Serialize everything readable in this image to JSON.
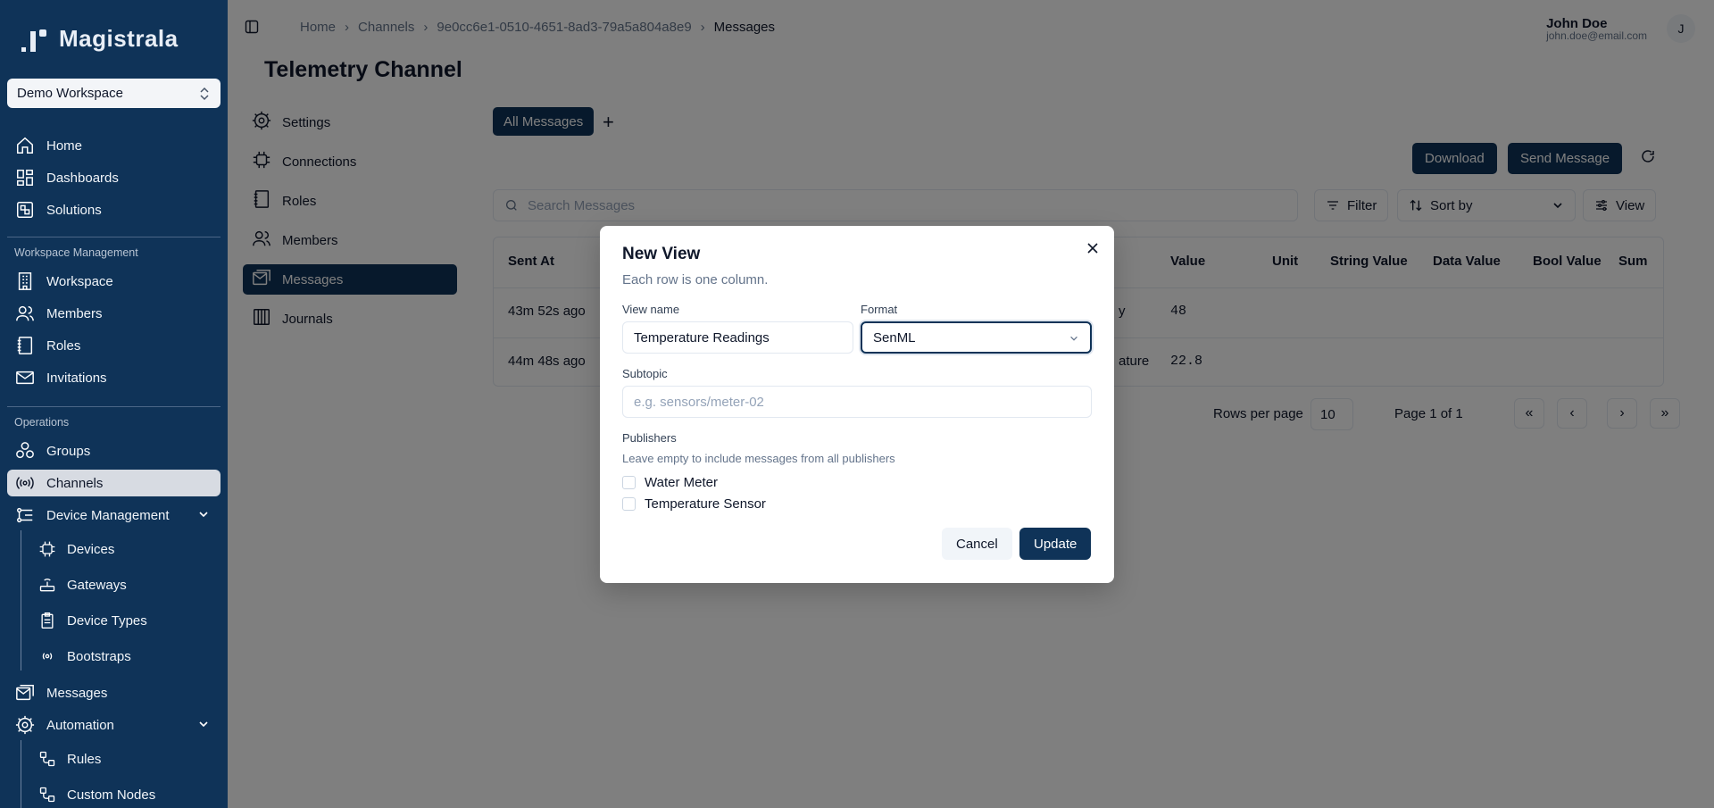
{
  "sidebar": {
    "brand": "Magistrala",
    "workspace": "Demo Workspace",
    "nav_top": [
      {
        "label": "Home",
        "icon": "home-icon"
      },
      {
        "label": "Dashboards",
        "icon": "dashboard-icon"
      },
      {
        "label": "Solutions",
        "icon": "solutions-icon"
      }
    ],
    "section_workspace": "Workspace Management",
    "nav_workspace": [
      {
        "label": "Workspace",
        "icon": "building-icon"
      },
      {
        "label": "Members",
        "icon": "users-icon"
      },
      {
        "label": "Roles",
        "icon": "notebook-icon"
      },
      {
        "label": "Invitations",
        "icon": "mail-icon"
      }
    ],
    "section_operations": "Operations",
    "nav_operations": [
      {
        "label": "Groups",
        "icon": "groups-icon"
      },
      {
        "label": "Channels",
        "icon": "broadcast-icon"
      },
      {
        "label": "Device Management",
        "icon": "device-management-icon"
      },
      {
        "label": "Devices",
        "icon": "chip-icon"
      },
      {
        "label": "Gateways",
        "icon": "router-icon"
      },
      {
        "label": "Device Types",
        "icon": "clipboard-icon"
      },
      {
        "label": "Bootstraps",
        "icon": "bootstrap-icon"
      },
      {
        "label": "Messages",
        "icon": "messages-icon"
      },
      {
        "label": "Automation",
        "icon": "gear-icon"
      },
      {
        "label": "Rules",
        "icon": "workflow-icon"
      },
      {
        "label": "Custom Nodes",
        "icon": "workflow-icon"
      }
    ]
  },
  "header": {
    "breadcrumb": [
      "Home",
      "Channels",
      "9e0cc6e1-0510-4651-8ad3-79a5a804a8e9",
      "Messages"
    ],
    "user_name": "John Doe",
    "user_email": "john.doe@email.com",
    "avatar_initial": "J"
  },
  "page": {
    "title": "Telemetry Channel",
    "subnav": [
      "Settings",
      "Connections",
      "Roles",
      "Members",
      "Messages",
      "Journals"
    ],
    "tab_all": "All Messages",
    "tab_add": "+",
    "download": "Download",
    "send_message": "Send Message",
    "search_placeholder": "Search Messages",
    "filter": "Filter",
    "sort_by": "Sort by",
    "view": "View"
  },
  "table": {
    "columns": [
      "Sent At",
      "Value",
      "Unit",
      "String Value",
      "Data Value",
      "Bool Value",
      "Sum"
    ],
    "rows": [
      {
        "sent_at": "43m 52s ago",
        "partial": "y",
        "value": "48"
      },
      {
        "sent_at": "44m 48s ago",
        "partial": "ature",
        "value": "22.8"
      }
    ]
  },
  "pagination": {
    "rows_per_page_label": "Rows per page",
    "rows_per_page": "10",
    "page_info": "Page 1 of 1"
  },
  "dialog": {
    "title": "New View",
    "description": "Each row is one column.",
    "view_name_label": "View name",
    "view_name_value": "Temperature Readings",
    "format_label": "Format",
    "format_value": "SenML",
    "subtopic_label": "Subtopic",
    "subtopic_placeholder": "e.g. sensors/meter-02",
    "publishers_label": "Publishers",
    "publishers_help": "Leave empty to include messages from all publishers",
    "publishers": [
      "Water Meter",
      "Temperature Sensor"
    ],
    "cancel": "Cancel",
    "update": "Update"
  },
  "colors": {
    "sidebar": "#0f3358",
    "accent": "#0f3358"
  }
}
